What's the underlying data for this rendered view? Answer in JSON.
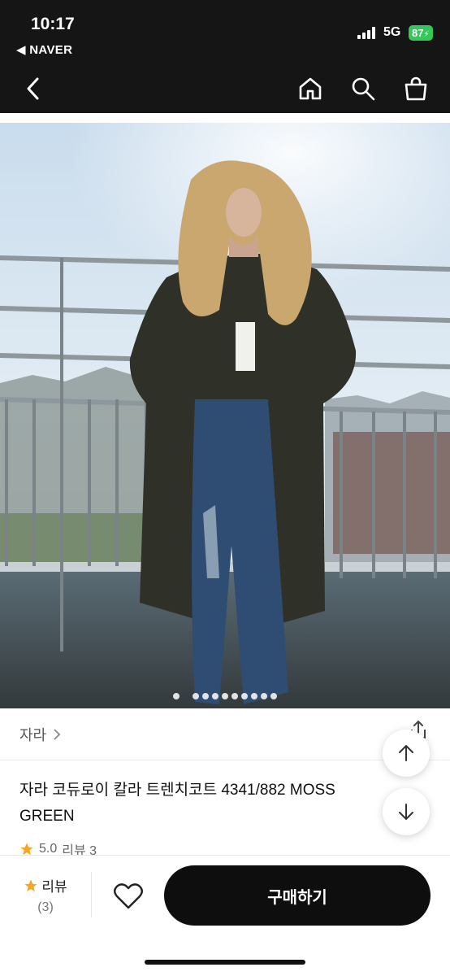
{
  "status_bar": {
    "time": "10:17",
    "back_app": "◀ NAVER",
    "network": "5G",
    "battery": "87"
  },
  "nav": {
    "icons": [
      "back-icon",
      "home-icon",
      "search-icon",
      "shopping-bag-icon"
    ]
  },
  "gallery": {
    "image_description": "product photo",
    "dot_count": 10,
    "active_index": 0
  },
  "product": {
    "brand": "자라",
    "brand_chevron": ">",
    "title": "자라 코듀로이 칼라 트렌치코트 4341/882 MOSS GREEN",
    "rating": "5.0",
    "review_text": "리뷰 3"
  },
  "floating": {
    "up_icon": "arrow-up-icon",
    "down_icon": "arrow-down-icon"
  },
  "bottom_bar": {
    "review_label": "리뷰",
    "review_count": "(3)",
    "buy_label": "구매하기"
  },
  "colors": {
    "dark_bar": "#151515",
    "star": "#f5a623",
    "battery": "#34c759",
    "buy_button": "#0e0e0e"
  }
}
